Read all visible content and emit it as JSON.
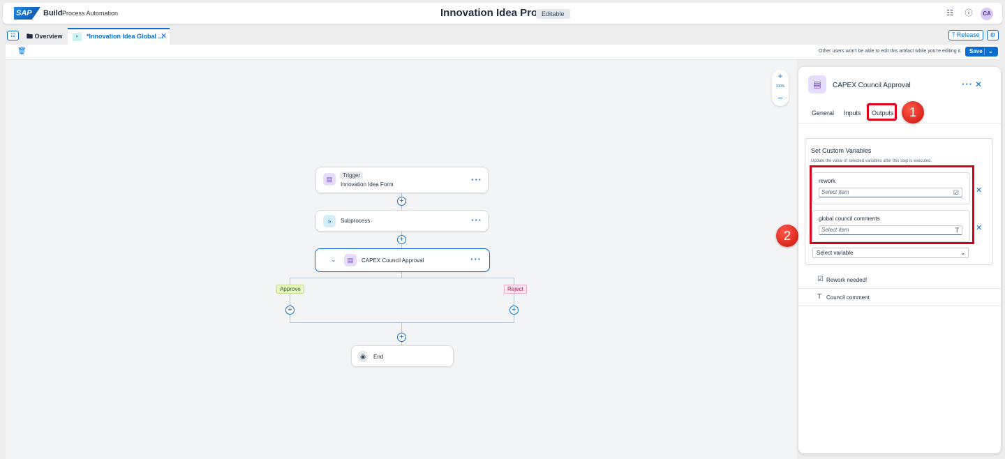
{
  "shell": {
    "logo": "SAP",
    "brand": "Build",
    "product": "Process Automation",
    "title": "Innovation Idea Process",
    "status": "Editable",
    "avatar": "CA"
  },
  "tabs": {
    "overview": "Overview",
    "active": "*Innovation Idea Global ...",
    "release": "Release"
  },
  "toolbar": {
    "note": "Other users won't be able to edit this artifact while you're editing it.",
    "save": "Save"
  },
  "canvas": {
    "zoom": "100%",
    "nodes": {
      "trigger_badge": "Trigger",
      "trigger_label": "Innovation Idea Form",
      "subprocess": "Subprocess",
      "approval": "CAPEX Council Approval",
      "end": "End"
    },
    "branches": {
      "approve": "Approve",
      "reject": "Reject"
    }
  },
  "panel": {
    "title": "CAPEX Council Approval",
    "tabs": [
      "General",
      "Inputs",
      "Outputs"
    ],
    "markers": [
      "1",
      "2"
    ],
    "section_title": "Set Custom Variables",
    "section_desc": "Update the value of selected variables after this step is executed.",
    "variables": [
      {
        "name": "rework",
        "placeholder": "Select item",
        "type_icon": "checkbox-icon"
      },
      {
        "name": "global council comments",
        "placeholder": "Select item",
        "type_icon": "text-type-icon"
      }
    ],
    "select_variable": "Select variable",
    "list": [
      {
        "label": "Rework needed!",
        "icon": "checkbox-icon"
      },
      {
        "label": "Council comment",
        "icon": "text-type-icon"
      }
    ]
  },
  "colors": {
    "accent": "#0a6ed1",
    "highlight": "#d8001a",
    "approve": "#256f14",
    "reject": "#a0104a"
  }
}
